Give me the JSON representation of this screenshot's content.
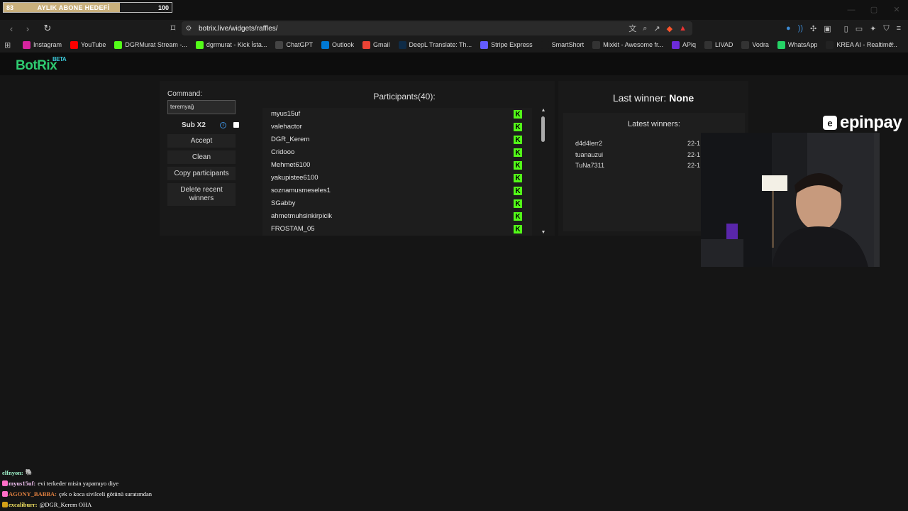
{
  "overlay_goal": {
    "current": "83",
    "label": "AYLIK ABONE HEDEFİ",
    "target": "100",
    "progress": 0.83
  },
  "browser": {
    "url": "botrix.live/widgets/raffles/",
    "bookmarks": [
      {
        "label": "Instagram",
        "color": "#d6249f",
        "icon": "instagram-icon"
      },
      {
        "label": "YouTube",
        "color": "#ff0000",
        "icon": "youtube-icon"
      },
      {
        "label": "DGRMurat Stream -...",
        "color": "#53fc18",
        "icon": "kick-icon"
      },
      {
        "label": "dgrmurat - Kick İsta...",
        "color": "#53fc18",
        "icon": "kick-icon"
      },
      {
        "label": "ChatGPT",
        "color": "#444444",
        "icon": "chatgpt-icon"
      },
      {
        "label": "Outlook",
        "color": "#0078d4",
        "icon": "outlook-icon"
      },
      {
        "label": "Gmail",
        "color": "#ea4335",
        "icon": "gmail-icon"
      },
      {
        "label": "DeepL Translate: Th...",
        "color": "#0f2b46",
        "icon": "deepl-icon"
      },
      {
        "label": "Stripe Express",
        "color": "#635bff",
        "icon": "stripe-icon"
      },
      {
        "label": "SmartShort",
        "color": "#1b1b1b",
        "icon": "smartshort-icon"
      },
      {
        "label": "Mixkit - Awesome fr...",
        "color": "#333333",
        "icon": "mixkit-icon"
      },
      {
        "label": "APiq",
        "color": "#6c2bd9",
        "icon": "apiq-icon"
      },
      {
        "label": "LIVAD",
        "color": "#333333",
        "icon": "livad-icon"
      },
      {
        "label": "Vodra",
        "color": "#333333",
        "icon": "vodra-icon"
      },
      {
        "label": "WhatsApp",
        "color": "#25d366",
        "icon": "whatsapp-icon"
      },
      {
        "label": "KREA AI - Realtime...",
        "color": "#222222",
        "icon": "krea-icon"
      }
    ]
  },
  "app": {
    "logo": "BotRix",
    "beta": "BETA"
  },
  "raffle": {
    "command_label": "Command:",
    "command_value": "teremyağ",
    "sub_label": "Sub X2",
    "buttons": {
      "accept": "Accept",
      "clean": "Clean",
      "copy": "Copy participants",
      "delete": "Delete recent winners"
    },
    "participants_title": "Participants(40):",
    "participants": [
      "myus15uf",
      "valehactor",
      "DGR_Kerem",
      "Cridooo",
      "Mehmet6100",
      "yakupistee6100",
      "soznamusmeseles1",
      "SGabby",
      "ahmetmuhsinkirpicik",
      "FROSTAM_05"
    ],
    "last_winner_label": "Last winner:",
    "last_winner_value": "None",
    "latest_title": "Latest winners:",
    "latest_winners": [
      {
        "name": "d4d4lerr2",
        "date": "22-1"
      },
      {
        "name": "tuanauzui",
        "date": "22-1"
      },
      {
        "name": "TuNa7311",
        "date": "22-1"
      }
    ]
  },
  "sponsor": {
    "mark": "e",
    "name": "epinpay"
  },
  "chat": [
    {
      "user": "elfnyon:",
      "color": "#9ef0c8",
      "message": "🐘",
      "badge": ""
    },
    {
      "user": "myus15uf:",
      "color": "#f0c0f0",
      "message": "evi terkeder misin yapamıyo diye",
      "badge": "#ff6ec7"
    },
    {
      "user": "AGONY_BABBA:",
      "color": "#e08040",
      "message": "çek o koca sivilceli götünü suratımdan",
      "badge": "#ff6ec7"
    },
    {
      "user": "excaliburr:",
      "color": "#f0e060",
      "message": "@DGR_Kerem OHA",
      "badge": "#d4a017"
    }
  ]
}
